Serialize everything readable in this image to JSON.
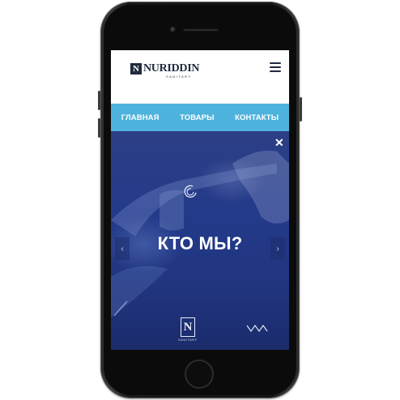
{
  "header": {
    "logo_mark": "N",
    "logo_text": "NURIDDIN",
    "logo_sub": "SANITARY"
  },
  "nav": {
    "items": [
      "ГЛАВНАЯ",
      "ТОВАРЫ",
      "КОНТАКТЫ"
    ]
  },
  "hero": {
    "title": "КТО МЫ?",
    "prev_arrow": "‹",
    "next_arrow": "›",
    "close": "✕",
    "footer_logo_mark": "N",
    "footer_logo_text": "SANITARY"
  },
  "colors": {
    "nav_bg": "#4eb3dc",
    "hero_bg": "#233a8a",
    "brand": "#1e2a3e"
  }
}
